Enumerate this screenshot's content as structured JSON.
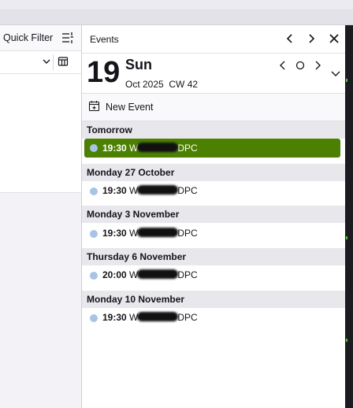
{
  "quick_filter": {
    "label": "Quick Filter"
  },
  "events_pane": {
    "title": "Events",
    "today": {
      "day_number": "19",
      "day_name": "Sun",
      "month_year": "Oct 2025",
      "week": "CW 42"
    },
    "new_event_label": "New Event",
    "groups": [
      {
        "label": "Tomorrow",
        "events": [
          {
            "time": "19:30",
            "name_prefix": "W",
            "name_suffix": "DPC",
            "selected": true
          }
        ]
      },
      {
        "label": "Monday 27 October",
        "events": [
          {
            "time": "19:30",
            "name_prefix": "W",
            "name_suffix": "DPC",
            "selected": false
          }
        ]
      },
      {
        "label": "Monday 3 November",
        "events": [
          {
            "time": "19:30",
            "name_prefix": "W",
            "name_suffix": "DPC",
            "selected": false
          }
        ]
      },
      {
        "label": "Thursday 6 November",
        "events": [
          {
            "time": "20:00",
            "name_prefix": "W",
            "name_suffix": "DPC",
            "selected": false
          }
        ]
      },
      {
        "label": "Monday 10 November",
        "events": [
          {
            "time": "19:30",
            "name_prefix": "W",
            "name_suffix": "DPC",
            "selected": false
          }
        ]
      }
    ]
  },
  "colors": {
    "selected_event": "#4c8000",
    "event_dot": "#a7c4e6",
    "group_header_bg": "#e8e7ec"
  }
}
